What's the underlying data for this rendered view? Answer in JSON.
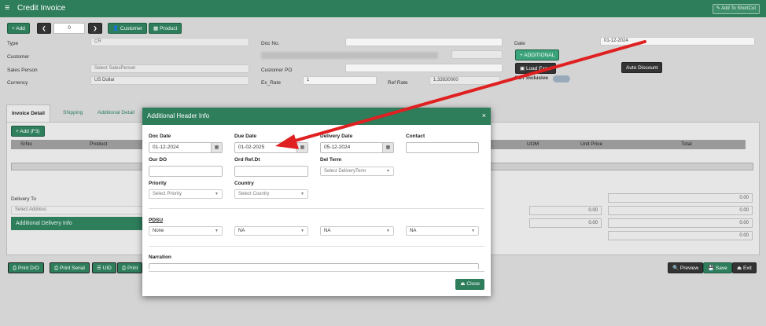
{
  "app": {
    "title": "Credit Invoice",
    "shortcut_label": "Add To ShortCut"
  },
  "toolbar": {
    "add": "+ Add",
    "page": "0",
    "customer": "Customer",
    "product": "Product"
  },
  "form": {
    "type_label": "Type",
    "type_value": "CR",
    "customer_label": "Customer",
    "sales_person_label": "Sales Person",
    "sales_person_placeholder": "Select SalesPerson",
    "currency_label": "Currency",
    "currency_value": "US Dollar",
    "doc_no_label": "Doc No.",
    "customer_po_label": "Customer PO",
    "ex_rate_label": "Ex_Rate",
    "ex_rate_value": "1",
    "ref_rate_label": "Ref Rate",
    "ref_rate_value": "1.33930000",
    "date_label": "Date",
    "date_value": "01-12-2024",
    "additional_btn": "+ ADDITIONAL",
    "load_excel_btn": "Load Excel",
    "auto_discount_btn": "Auto Discount",
    "gst_inclusive_label": "GST Inclusive"
  },
  "tabs": [
    "Invoice Detail",
    "Shipping",
    "Additional Detail"
  ],
  "grid": {
    "add_btn": "+ Add (F3)",
    "headers": [
      "SrNo",
      "Product",
      "UOM",
      "Unit Price",
      "Total"
    ]
  },
  "delivery": {
    "label": "Delivery To",
    "address_placeholder": "Select Address",
    "additional_info": "Additional Delivery Info"
  },
  "totals": [
    "0.00",
    "0.00",
    "0.00",
    "0.00",
    "0.00",
    "0.00",
    "0.00"
  ],
  "footer": {
    "print_do": "Print D/O",
    "print_serial": "Print Serial",
    "uid": "UID",
    "print": "Print",
    "preview": "Preview",
    "save": "Save",
    "exit": "Exit"
  },
  "modal": {
    "title": "Additional Header Info",
    "close_icon": "×",
    "doc_date_label": "Doc Date",
    "doc_date_value": "01-12-2024",
    "due_date_label": "Due Date",
    "due_date_value": "01-02-2025",
    "delivery_date_label": "Delivery Date",
    "delivery_date_value": "05-12-2024",
    "contact_label": "Contact",
    "our_do_label": "Our DO",
    "ord_ref_label": "Ord Ref.Dt",
    "del_term_label": "Del Term",
    "del_term_placeholder": "Select DeliveryTerm",
    "priority_label": "Priority",
    "priority_placeholder": "Select Priority",
    "country_label": "Country",
    "country_placeholder": "Select Country",
    "pdsu_label": "PDSU",
    "pdsu_values": [
      "None",
      "NA",
      "NA",
      "NA"
    ],
    "narration_label": "Narration",
    "close_btn": "Close"
  },
  "colors": {
    "accent": "#2e7d5b",
    "arrow": "#e02020"
  }
}
